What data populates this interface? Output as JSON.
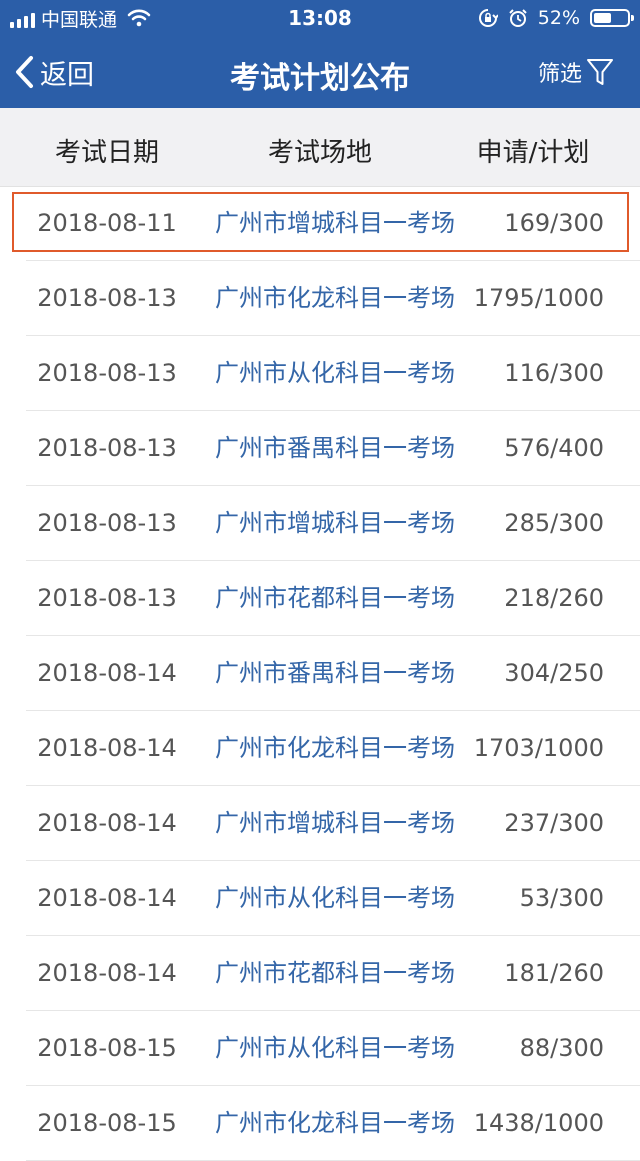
{
  "status_bar": {
    "carrier": "中国联通",
    "time": "13:08",
    "battery": "52%",
    "battery_level": 0.52,
    "icons": [
      "signal-icon",
      "wifi-icon",
      "orientation-lock-icon",
      "alarm-icon",
      "battery-icon"
    ]
  },
  "nav": {
    "back_label": "返回",
    "title": "考试计划公布",
    "filter_label": "筛选",
    "colors": {
      "bar": "#2b5ea8",
      "text": "#ffffff"
    }
  },
  "table": {
    "headers": [
      "考试日期",
      "考试场地",
      "申请/计划"
    ],
    "rows": [
      {
        "date": "2018-08-11",
        "venue": "广州市增城科目一考场",
        "ratio": "169/300"
      },
      {
        "date": "2018-08-13",
        "venue": "广州市化龙科目一考场",
        "ratio": "1795/1000"
      },
      {
        "date": "2018-08-13",
        "venue": "广州市从化科目一考场",
        "ratio": "116/300"
      },
      {
        "date": "2018-08-13",
        "venue": "广州市番禺科目一考场",
        "ratio": "576/400"
      },
      {
        "date": "2018-08-13",
        "venue": "广州市增城科目一考场",
        "ratio": "285/300"
      },
      {
        "date": "2018-08-13",
        "venue": "广州市花都科目一考场",
        "ratio": "218/260"
      },
      {
        "date": "2018-08-14",
        "venue": "广州市番禺科目一考场",
        "ratio": "304/250"
      },
      {
        "date": "2018-08-14",
        "venue": "广州市化龙科目一考场",
        "ratio": "1703/1000"
      },
      {
        "date": "2018-08-14",
        "venue": "广州市增城科目一考场",
        "ratio": "237/300"
      },
      {
        "date": "2018-08-14",
        "venue": "广州市从化科目一考场",
        "ratio": "53/300"
      },
      {
        "date": "2018-08-14",
        "venue": "广州市花都科目一考场",
        "ratio": "181/260"
      },
      {
        "date": "2018-08-15",
        "venue": "广州市从化科目一考场",
        "ratio": "88/300"
      },
      {
        "date": "2018-08-15",
        "venue": "广州市化龙科目一考场",
        "ratio": "1438/1000"
      }
    ],
    "colors": {
      "venue_text": "#3466a8",
      "highlight_border": "#e05a2b",
      "header_bg": "#f1f1f3"
    }
  }
}
